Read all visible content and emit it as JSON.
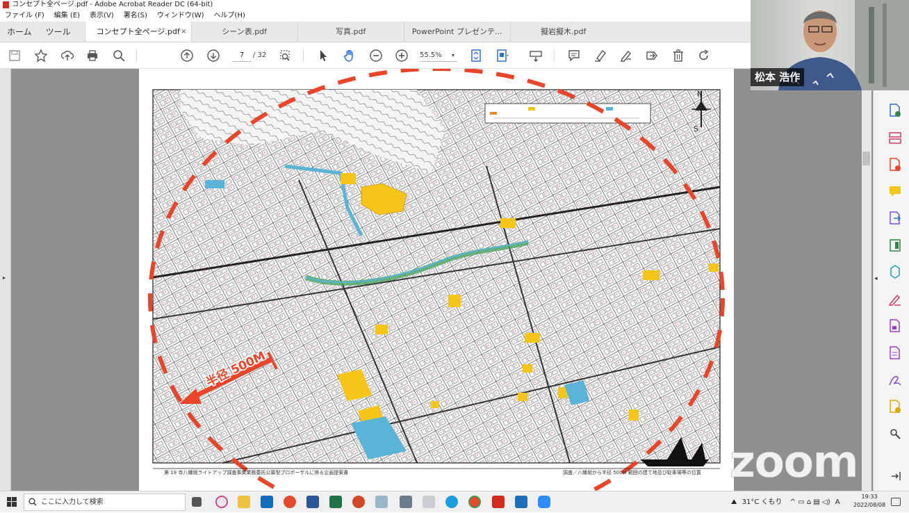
{
  "window": {
    "title": "コンセプト全ページ.pdf - Adobe Acrobat Reader DC (64-bit)"
  },
  "menu": [
    "ファイル (F)",
    "編集 (E)",
    "表示(V)",
    "署名(S)",
    "ウィンドウ(W)",
    "ヘルプ(H)"
  ],
  "nav_tabs": [
    "ホーム",
    "ツール"
  ],
  "doc_tabs": [
    {
      "label": "コンセプト全ページ.pdf",
      "active": true,
      "close": "×"
    },
    {
      "label": "シーン表.pdf",
      "active": false
    },
    {
      "label": "写真.pdf",
      "active": false
    },
    {
      "label": "PowerPoint プレゼンテ...",
      "active": false
    },
    {
      "label": "擬岩擬木.pdf",
      "active": false
    }
  ],
  "toolbar": {
    "page_current": "7",
    "page_total": "/ 32",
    "zoom": "55.5%",
    "icons": [
      "save-icon",
      "star-icon",
      "upload-icon",
      "print-icon",
      "zoom-search-icon",
      "page-up-icon",
      "page-down-icon",
      "select-text-icon",
      "arrow-cursor-icon",
      "hand-icon",
      "zoom-out-icon",
      "zoom-in-icon",
      "fit-page-icon",
      "page-display-icon",
      "keyboard-icon",
      "comment-icon",
      "highlight-icon",
      "sign-icon",
      "share-icon",
      "delete-icon",
      "rotate-icon"
    ]
  },
  "map": {
    "radius_label": "半径 500M",
    "footer_left": "第 19 寺八幡堀ライトアップ調査事業業務委託公募型プロポーザルに係る企画提案書",
    "footer_right": "調査／八幡堀から半径 500M 範囲の建て地及び駐車場等の位置",
    "north": "N",
    "south": "S"
  },
  "video": {
    "participant_name": "松本 浩作"
  },
  "watermark": "ZOOM",
  "taskbar": {
    "search_placeholder": "ここに入力して検索",
    "weather": "31°C くもり",
    "ime": "A",
    "time": "19:33",
    "date": "2022/08/08"
  },
  "colors": {
    "acrobat_blue": "#2d6fd1",
    "route_red": "#e8452a",
    "highlight_yellow": "#f5c518",
    "park_blue": "#5ab4d8",
    "tree_green": "#4aa562"
  }
}
